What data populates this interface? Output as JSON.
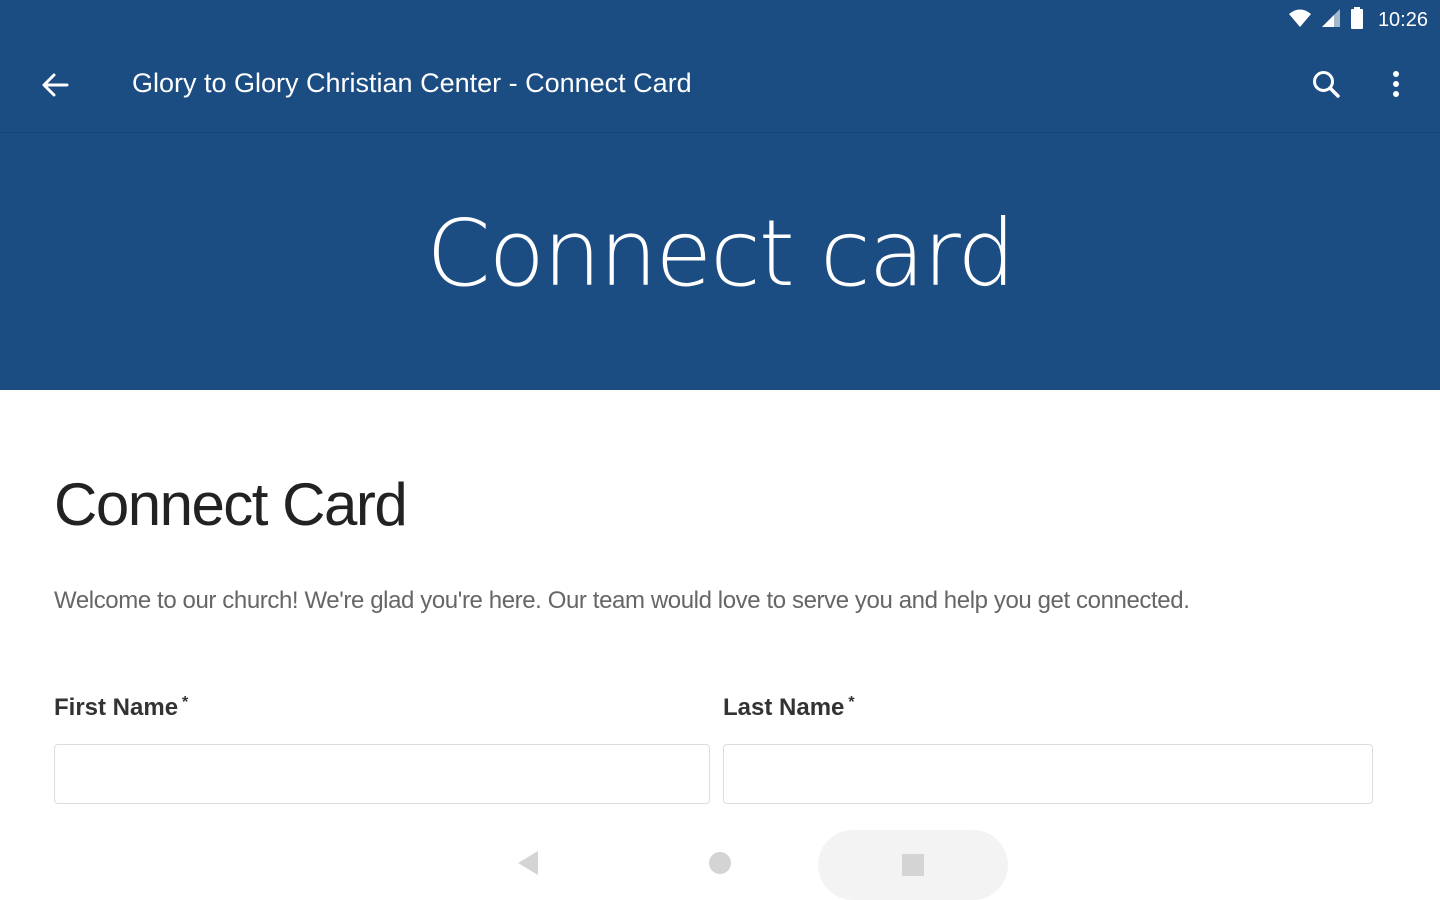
{
  "status_bar": {
    "time": "10:26"
  },
  "app_bar": {
    "title": "Glory to Glory Christian Center - Connect Card",
    "icons": [
      "arrow-back-icon",
      "search-icon",
      "more-vert-icon"
    ]
  },
  "hero": {
    "title": "Connect card"
  },
  "main": {
    "title": "Connect Card",
    "intro": "Welcome to our church! We're glad you're here. Our team would love to serve you and help you get connected.",
    "fields": [
      {
        "label": "First Name",
        "required_mark": "*",
        "value": "",
        "placeholder": ""
      },
      {
        "label": "Last Name",
        "required_mark": "*",
        "value": "",
        "placeholder": ""
      }
    ]
  },
  "nav_bar": {
    "icons": [
      "nav-back-icon",
      "nav-home-icon",
      "nav-recents-icon"
    ]
  },
  "colors": {
    "header_bg": "#1b4c82",
    "page_bg": "#ffffff",
    "input_border": "#dddddd"
  }
}
